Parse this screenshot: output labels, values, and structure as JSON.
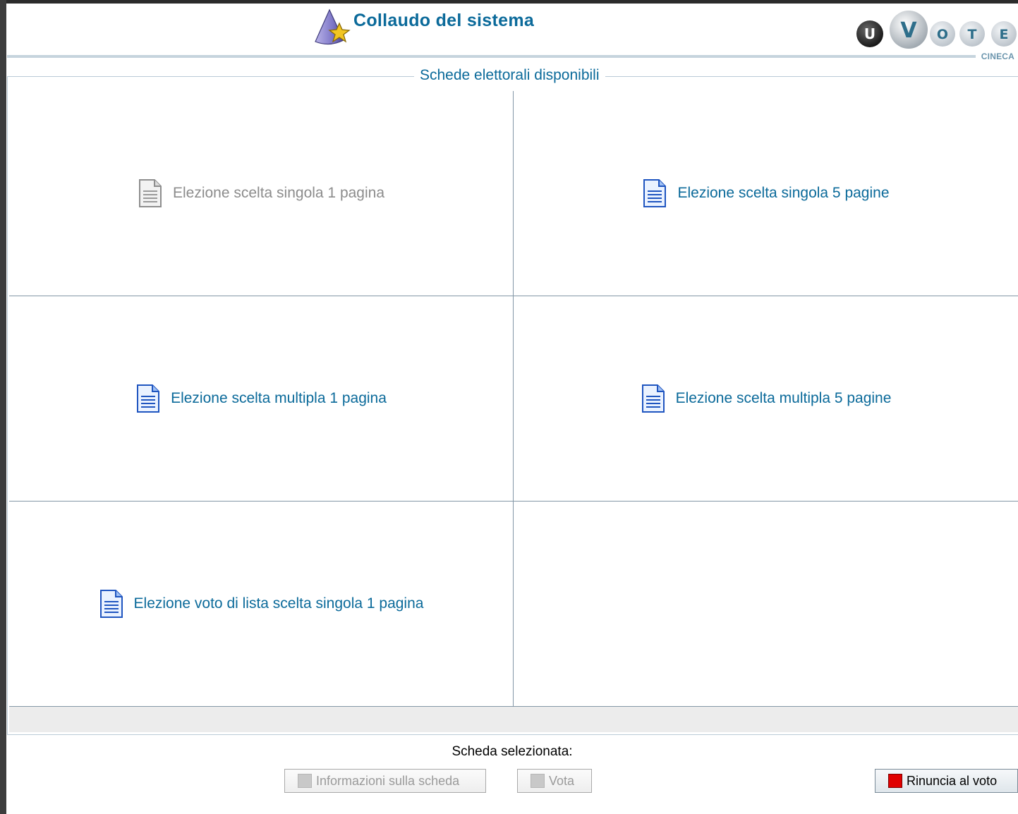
{
  "header": {
    "title": "Collaudo del sistema",
    "logo_letters": [
      "U",
      "V",
      "O",
      "T",
      "E"
    ],
    "logo_caption": "CINECA"
  },
  "ballots": {
    "legend": "Schede elettorali disponibili",
    "items": [
      {
        "label": "Elezione scelta singola 1 pagina",
        "enabled": false
      },
      {
        "label": "Elezione scelta singola 5 pagine",
        "enabled": true
      },
      {
        "label": "Elezione scelta multipla 1 pagina",
        "enabled": true
      },
      {
        "label": "Elezione scelta multipla 5 pagine",
        "enabled": true
      },
      {
        "label": "Elezione voto di lista scelta singola 1 pagina",
        "enabled": true
      }
    ]
  },
  "footer": {
    "selected_label": "Scheda selezionata:",
    "info_button": "Informazioni sulla scheda",
    "vote_button": "Vota",
    "renounce_button": "Rinuncia al voto"
  },
  "colors": {
    "accent": "#0b6a9a",
    "disabled_text": "#8c8c8c",
    "renounce_red": "#e00000"
  }
}
